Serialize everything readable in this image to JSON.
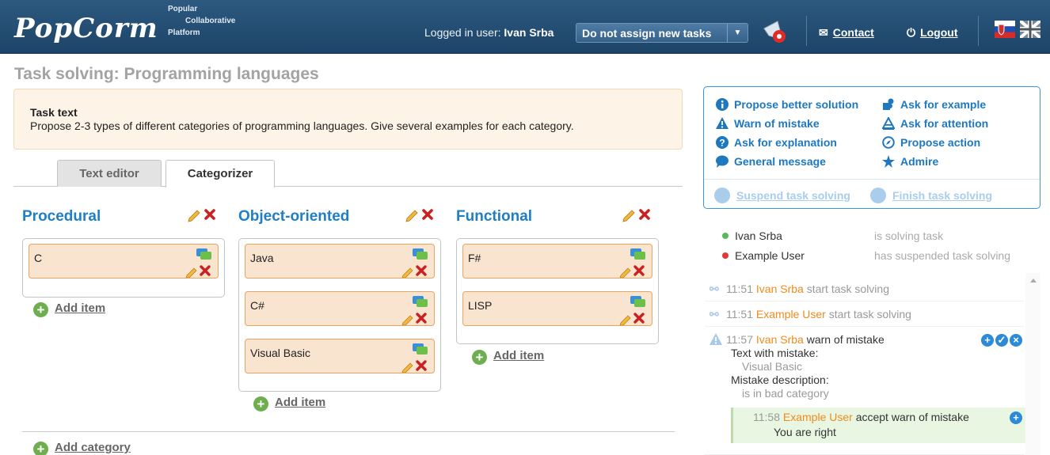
{
  "header": {
    "logo": "PopCorm",
    "tagline": [
      "Popular",
      "Collaborative",
      "Platform"
    ],
    "logged_prefix": "Logged in user:",
    "logged_user": "Ivan Srba",
    "assign_select": "Do not assign new tasks",
    "contact": "Contact",
    "logout": "Logout"
  },
  "page": {
    "title": "Task solving: Programming languages",
    "task_heading": "Task text",
    "task_text": "Propose 2-3 types of different categories of programming languages. Give several examples for each category.",
    "tabs": [
      "Text editor",
      "Categorizer"
    ]
  },
  "categories": [
    {
      "title": "Procedural",
      "items": [
        "C"
      ],
      "add_item": "Add item"
    },
    {
      "title": "Object-oriented",
      "items": [
        "Java",
        "C#",
        "Visual Basic"
      ],
      "add_item": "Add item"
    },
    {
      "title": "Functional",
      "items": [
        "F#",
        "LISP"
      ],
      "add_item": "Add item"
    }
  ],
  "add_category": "Add category",
  "actions": {
    "propose_better": "Propose better solution",
    "ask_example": "Ask for example",
    "warn_mistake": "Warn of mistake",
    "ask_attention": "Ask for attention",
    "ask_explanation": "Ask for explanation",
    "propose_action": "Propose action",
    "general_message": "General message",
    "admire": "Admire",
    "suspend": "Suspend task solving",
    "finish": "Finish task solving"
  },
  "users": [
    {
      "name": "Ivan Srba",
      "status": "is solving task",
      "color": "#5cb85c"
    },
    {
      "name": "Example User",
      "status": "has suspended task solving",
      "color": "#e53935"
    }
  ],
  "log": {
    "e1": {
      "time": "11:51",
      "user": "Ivan Srba",
      "text": "start task solving"
    },
    "e2": {
      "time": "11:51",
      "user": "Example User",
      "text": "start task solving"
    },
    "e3": {
      "time": "11:57",
      "user": "Ivan Srba",
      "text": "warn of mistake",
      "l1": "Text with mistake:",
      "l2": "Visual Basic",
      "l3": "Mistake description:",
      "l4": "is in bad category"
    },
    "e4": {
      "time": "11:58",
      "user": "Example User",
      "text": "accept warn of mistake",
      "reply": "You are right"
    }
  },
  "colors": {
    "header": "#244f76",
    "accent": "#1f7fc6",
    "item_bg": "#f9e4cf",
    "item_border": "#e8a460",
    "user_link": "#f08a1d"
  }
}
